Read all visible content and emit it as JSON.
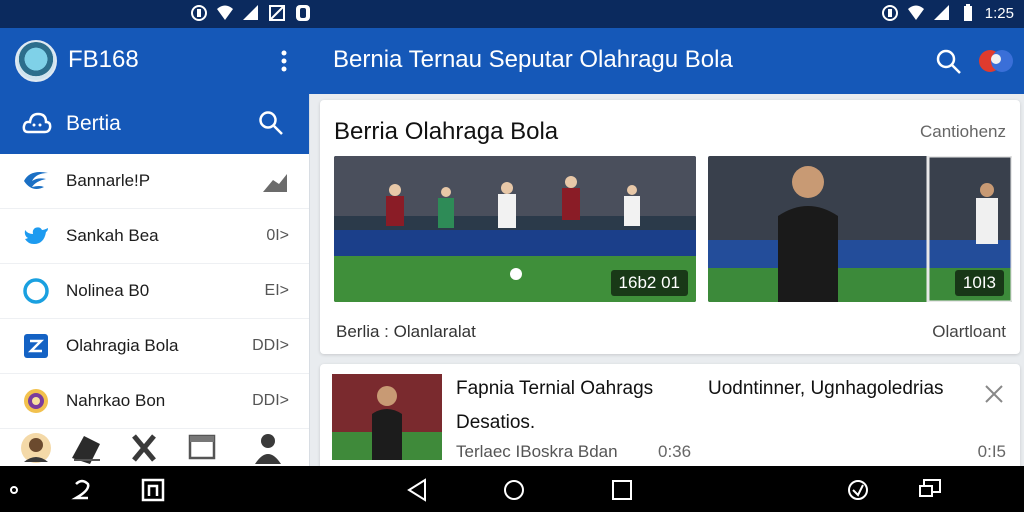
{
  "status_bar": {
    "time": "1:25",
    "icons": [
      "data-icon",
      "wifi-icon",
      "signal-icon",
      "no-signal-icon",
      "nfc-icon",
      "data-icon",
      "wifi-icon",
      "signal-icon",
      "battery-icon"
    ]
  },
  "app_bar": {
    "app_name": "FB168",
    "page_title": "Bernia Ternau Seputar Olahragu Bola"
  },
  "sidebar": {
    "header_label": "Bertia",
    "items": [
      {
        "label": "Bannarle!P",
        "icon": "wave-logo-icon",
        "trail": ""
      },
      {
        "label": "Sankah Bea",
        "icon": "bird-icon",
        "trail": "0I>"
      },
      {
        "label": "Nolinea B0",
        "icon": "ring-icon",
        "trail": "EI>"
      },
      {
        "label": "Olahragia Bola",
        "icon": "square-logo-icon",
        "trail": "DDI>"
      },
      {
        "label": "Nahrkao Bon",
        "icon": "circle-emblem-icon",
        "trail": "DDI>"
      }
    ]
  },
  "card1": {
    "title": "Berria Olahraga Bola",
    "more": "Cantiohenz",
    "thumb1_badge": "16b2 01",
    "thumb2_badge": "10I3",
    "caption_left": "Berlia : Olanlaralat",
    "caption_right": "Olartloant"
  },
  "card2": {
    "title_1": "Fapnia Ternial Oahrags",
    "title_2": "Uodntinner, Ugnhagoledrias",
    "title_3": "Desatios.",
    "meta_1": "Terlaec IBoskra Bdan",
    "meta_2": "0:36",
    "meta_3": "0:I5"
  },
  "colors": {
    "primary": "#1558b8",
    "status_bar": "#0b2a5e",
    "nav_bar": "#000000"
  }
}
